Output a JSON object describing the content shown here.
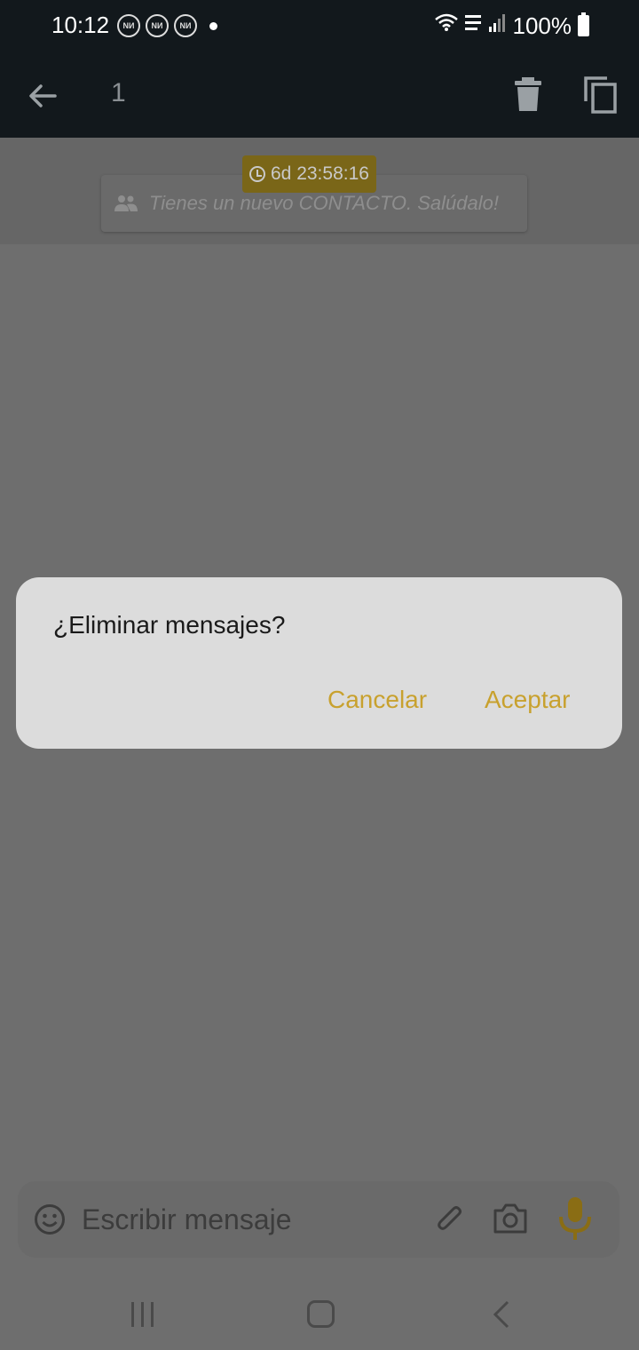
{
  "status_bar": {
    "time": "10:12",
    "notification_label": "NИ",
    "battery": "100%"
  },
  "toolbar": {
    "selected_count": "1"
  },
  "chat": {
    "timer": "6d 23:58:16",
    "contact_notice": "Tienes un nuevo CONTACTO. Salúdalo!"
  },
  "dialog": {
    "title": "¿Eliminar mensajes?",
    "cancel_label": "Cancelar",
    "accept_label": "Aceptar"
  },
  "composer": {
    "placeholder": "Escribir mensaje"
  },
  "colors": {
    "accent": "#c8a12e",
    "toolbar_bg": "#12181c",
    "dialog_bg": "#dcdcdc"
  },
  "icons": {
    "toolbar": [
      "back-arrow-icon",
      "trash-icon",
      "copy-icon"
    ],
    "composer": [
      "emoji-icon",
      "attach-icon",
      "camera-icon",
      "mic-icon"
    ],
    "navbar": [
      "recent-apps-icon",
      "home-icon",
      "nav-back-icon"
    ]
  }
}
